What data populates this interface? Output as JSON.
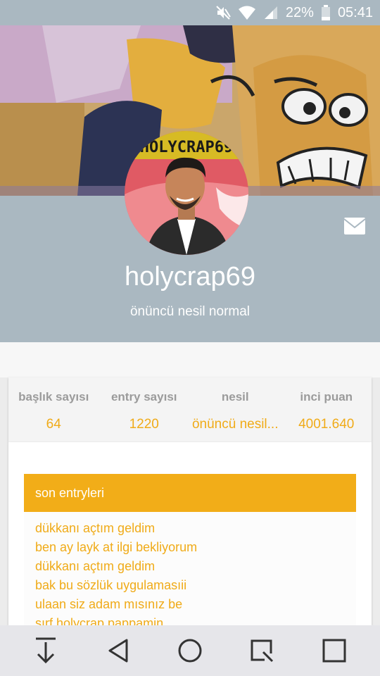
{
  "status_bar": {
    "battery_percent": "22%",
    "time": "05:41",
    "icons": [
      "mute-icon",
      "wifi-icon",
      "signal-icon",
      "battery-icon"
    ]
  },
  "cover": {
    "description_icon": "cartoon-cover-image"
  },
  "avatar": {
    "banner_text": "HOLYCRAP69"
  },
  "profile": {
    "username": "holycrap69",
    "title": "önüncü nesil normal"
  },
  "stats": [
    {
      "label": "başlık sayısı",
      "value": "64"
    },
    {
      "label": "entry sayısı",
      "value": "1220"
    },
    {
      "label": "nesil",
      "value": "önüncü nesil..."
    },
    {
      "label": "inci puan",
      "value": "4001.640"
    }
  ],
  "recent": {
    "header": "son entryleri",
    "items": [
      "dükkanı açtım geldim",
      "ben ay layk at ilgi bekliyorum",
      "dükkanı açtım geldim",
      "bak bu sözlük uygulamasıii",
      "ulaan siz adam mısınız be",
      "sırf holycrap pappamin"
    ]
  },
  "colors": {
    "accent": "#f2ad18",
    "band": "#aab8c1",
    "nav": "#e6e6ea"
  },
  "nav": {
    "icons": [
      "download-icon",
      "back-icon",
      "home-icon",
      "screenshot-icon",
      "recents-icon"
    ]
  }
}
